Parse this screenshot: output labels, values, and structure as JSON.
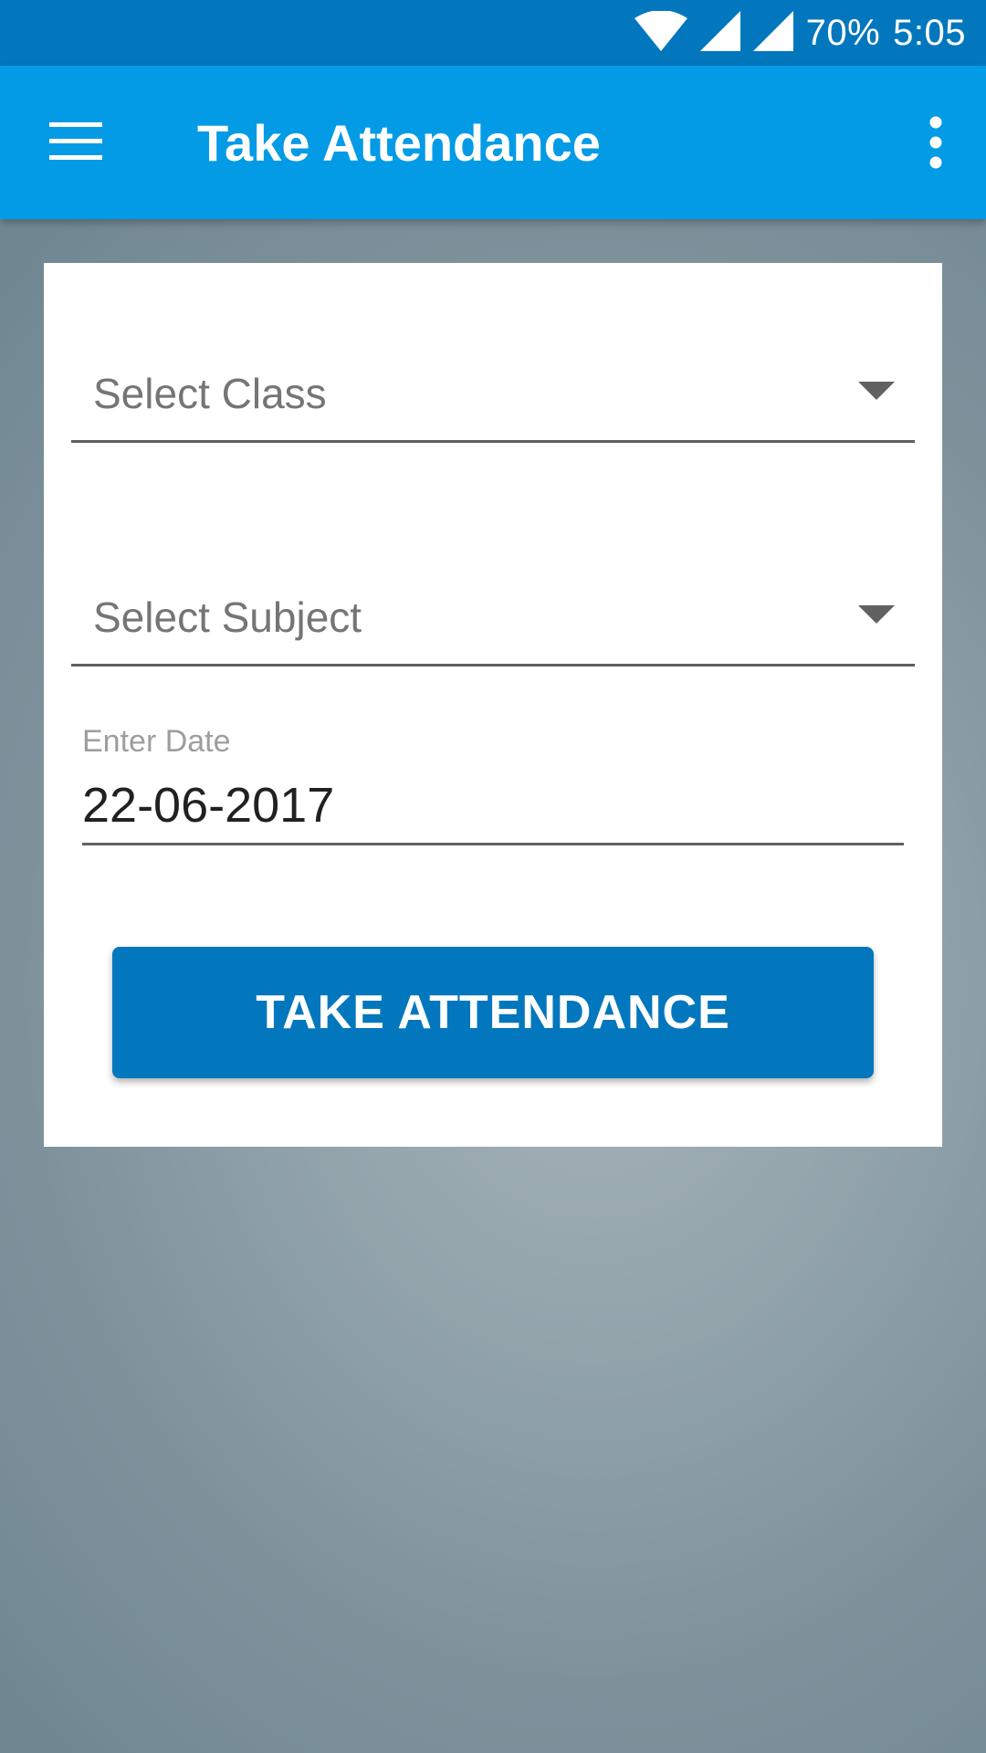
{
  "status_bar": {
    "battery": "70%",
    "time": "5:05",
    "icons": [
      "wifi-icon",
      "signal-icon",
      "signal-icon"
    ]
  },
  "app_bar": {
    "title": "Take Attendance",
    "menu_icon": "menu-icon",
    "overflow_icon": "more-vert-icon"
  },
  "form": {
    "class_spinner": {
      "placeholder": "Select Class",
      "icon": "dropdown-arrow-icon"
    },
    "subject_spinner": {
      "placeholder": "Select Subject",
      "icon": "dropdown-arrow-icon"
    },
    "date": {
      "label": "Enter Date",
      "value": "22-06-2017"
    },
    "submit_label": "TAKE ATTENDANCE"
  },
  "colors": {
    "status_bar": "#0277bd",
    "app_bar": "#039be5",
    "button": "#0277bd",
    "card": "#ffffff"
  }
}
